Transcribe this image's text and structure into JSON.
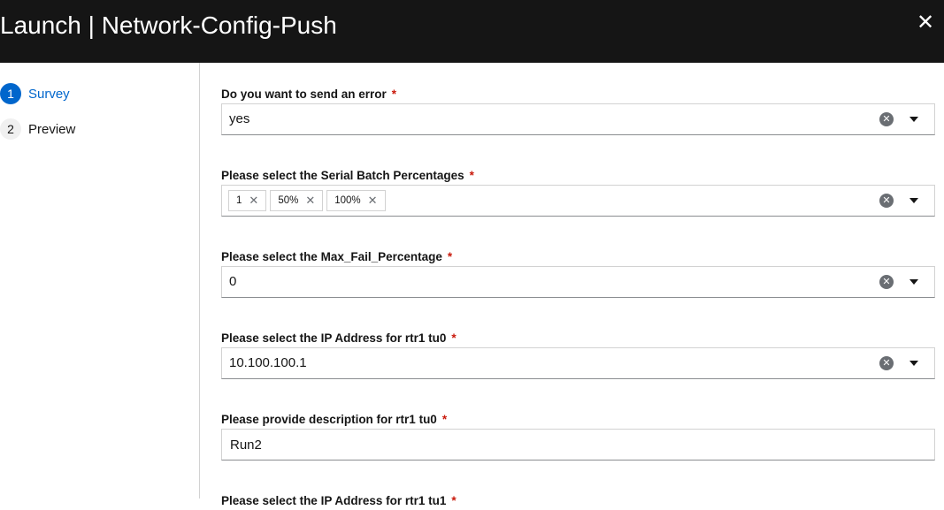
{
  "header": {
    "title": "Launch | Network-Config-Push",
    "close_icon": "close-icon"
  },
  "wizard": {
    "steps": [
      {
        "number": "1",
        "label": "Survey",
        "active": true
      },
      {
        "number": "2",
        "label": "Preview",
        "active": false
      }
    ]
  },
  "survey": {
    "required_mark": "*",
    "q1": {
      "label": "Do you want to send an error",
      "value": "yes"
    },
    "q2": {
      "label": "Please select the Serial Batch Percentages",
      "chips": [
        "1",
        "50%",
        "100%"
      ]
    },
    "q3": {
      "label": "Please select the Max_Fail_Percentage",
      "value": "0"
    },
    "q4": {
      "label": "Please select the IP Address for rtr1 tu0",
      "value": "10.100.100.1"
    },
    "q5": {
      "label": "Please provide description for rtr1 tu0",
      "value": "Run2"
    },
    "q6": {
      "label": "Please select the IP Address for rtr1 tu1"
    }
  },
  "icons": {
    "clear": "clear-circle-icon",
    "toggle": "caret-down-icon",
    "chip_remove": "times-icon"
  },
  "colors": {
    "header_bg": "#151515",
    "accent": "#0066cc",
    "required": "#c9190b"
  }
}
